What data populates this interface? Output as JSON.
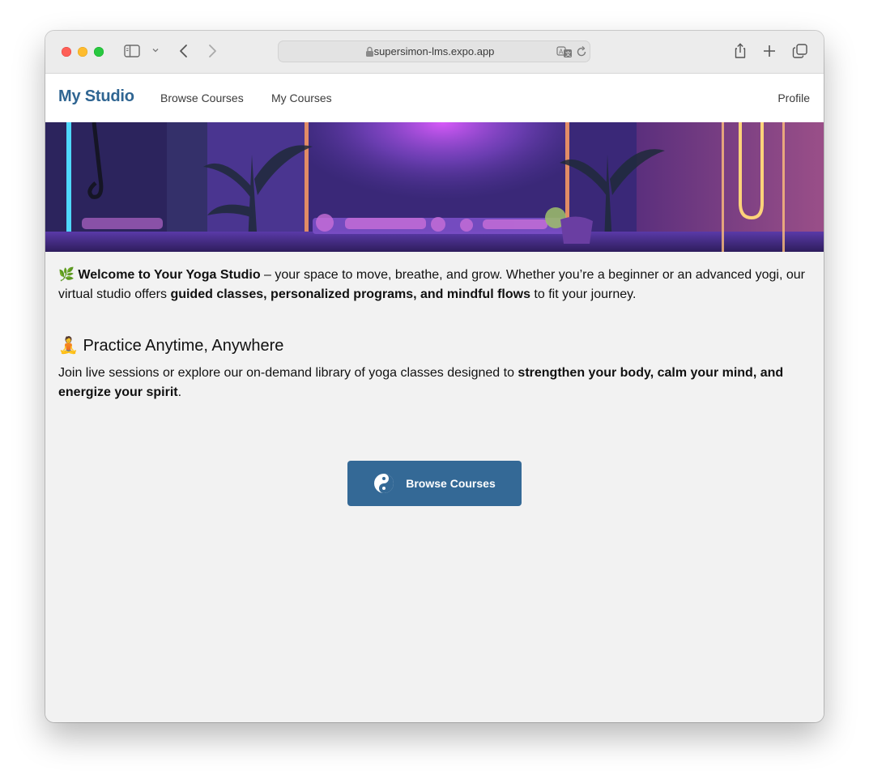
{
  "browser": {
    "url": "supersimon-lms.expo.app"
  },
  "nav": {
    "brand": "My Studio",
    "links": [
      {
        "label": "Browse Courses"
      },
      {
        "label": "My Courses"
      }
    ],
    "profile": "Profile"
  },
  "intro": {
    "emoji": "🌿",
    "bold_title": "Welcome to Your Yoga Studio",
    "text_1": " – your space to move, breathe, and grow. Whether you’re a beginner or an advanced yogi, our virtual studio offers ",
    "bold_features": "guided classes, personalized programs, and mindful flows",
    "text_2": " to fit your journey."
  },
  "practice": {
    "emoji": "🧘",
    "heading": "Practice Anytime, Anywhere",
    "text_1": "Join live sessions or explore our on-demand library of yoga classes designed to ",
    "bold": "strengthen your body, calm your mind, and energize your spirit",
    "text_2": "."
  },
  "cta": {
    "icon": "yin-yang-icon",
    "label": "Browse Courses"
  },
  "colors": {
    "brand": "#2f6592",
    "button": "#346996",
    "page_bg": "#f2f2f2"
  }
}
